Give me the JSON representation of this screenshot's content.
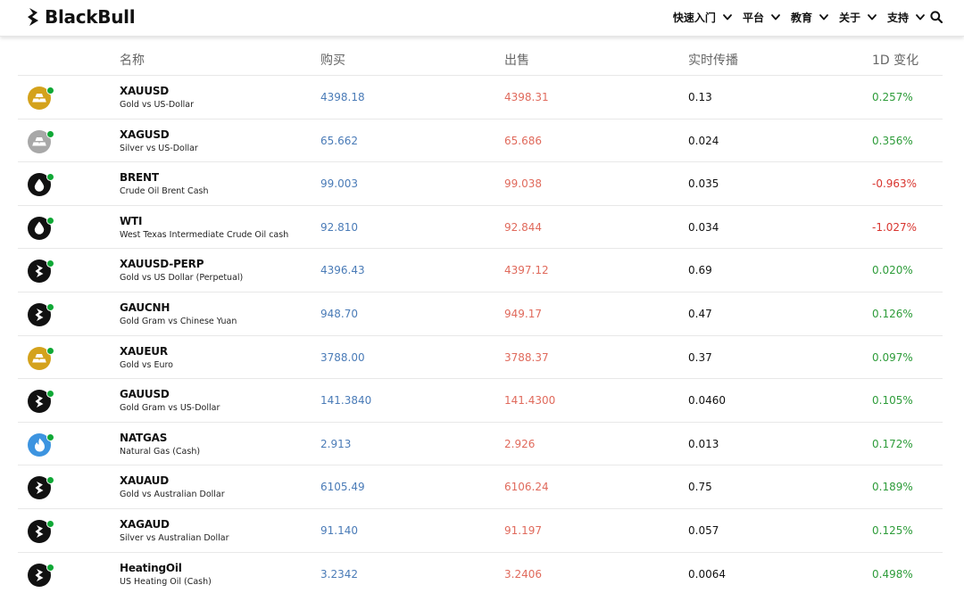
{
  "header": {
    "brand": "BlackBull",
    "nav": [
      {
        "label": "快速入门"
      },
      {
        "label": "平台"
      },
      {
        "label": "教育"
      },
      {
        "label": "关于"
      },
      {
        "label": "支持"
      }
    ]
  },
  "colors": {
    "buy": "#4a7bb7",
    "sell": "#e06a5c",
    "positive": "#2e9c3a",
    "negative": "#d8352f",
    "status_dot": "#10a836",
    "gold": "#d4a21c",
    "silver": "#a8a8a8",
    "gas": "#3d94e0",
    "dark": "#111111"
  },
  "table": {
    "columns": {
      "name": "名称",
      "buy": "购买",
      "sell": "出售",
      "spread": "实时传播",
      "change": "1D 变化"
    },
    "rows": [
      {
        "symbol": "XAUUSD",
        "description": "Gold vs US-Dollar",
        "buy": "4398.18",
        "sell": "4398.31",
        "spread": "0.13",
        "change": "0.257%",
        "direction": "up",
        "icon": "gold-bars-icon"
      },
      {
        "symbol": "XAGUSD",
        "description": "Silver vs US-Dollar",
        "buy": "65.662",
        "sell": "65.686",
        "spread": "0.024",
        "change": "0.356%",
        "direction": "up",
        "icon": "silver-bars-icon"
      },
      {
        "symbol": "BRENT",
        "description": "Crude Oil Brent Cash",
        "buy": "99.003",
        "sell": "99.038",
        "spread": "0.035",
        "change": "-0.963%",
        "direction": "down",
        "icon": "oil-drop-icon"
      },
      {
        "symbol": "WTI",
        "description": "West Texas Intermediate Crude Oil cash",
        "buy": "92.810",
        "sell": "92.844",
        "spread": "0.034",
        "change": "-1.027%",
        "direction": "down",
        "icon": "oil-drop-icon"
      },
      {
        "symbol": "XAUUSD-PERP",
        "description": "Gold vs US Dollar (Perpetual)",
        "buy": "4396.43",
        "sell": "4397.12",
        "spread": "0.69",
        "change": "0.020%",
        "direction": "up",
        "icon": "blackbull-icon"
      },
      {
        "symbol": "GAUCNH",
        "description": "Gold Gram vs Chinese Yuan",
        "buy": "948.70",
        "sell": "949.17",
        "spread": "0.47",
        "change": "0.126%",
        "direction": "up",
        "icon": "blackbull-icon"
      },
      {
        "symbol": "XAUEUR",
        "description": "Gold vs Euro",
        "buy": "3788.00",
        "sell": "3788.37",
        "spread": "0.37",
        "change": "0.097%",
        "direction": "up",
        "icon": "gold-bars-icon"
      },
      {
        "symbol": "GAUUSD",
        "description": "Gold Gram vs US-Dollar",
        "buy": "141.3840",
        "sell": "141.4300",
        "spread": "0.0460",
        "change": "0.105%",
        "direction": "up",
        "icon": "blackbull-icon"
      },
      {
        "symbol": "NATGAS",
        "description": "Natural Gas (Cash)",
        "buy": "2.913",
        "sell": "2.926",
        "spread": "0.013",
        "change": "0.172%",
        "direction": "up",
        "icon": "gas-flame-icon"
      },
      {
        "symbol": "XAUAUD",
        "description": "Gold vs Australian Dollar",
        "buy": "6105.49",
        "sell": "6106.24",
        "spread": "0.75",
        "change": "0.189%",
        "direction": "up",
        "icon": "blackbull-icon"
      },
      {
        "symbol": "XAGAUD",
        "description": "Silver vs Australian Dollar",
        "buy": "91.140",
        "sell": "91.197",
        "spread": "0.057",
        "change": "0.125%",
        "direction": "up",
        "icon": "blackbull-icon"
      },
      {
        "symbol": "HeatingOil",
        "description": "US Heating Oil (Cash)",
        "buy": "3.2342",
        "sell": "3.2406",
        "spread": "0.0064",
        "change": "0.498%",
        "direction": "up",
        "icon": "blackbull-icon"
      }
    ]
  }
}
